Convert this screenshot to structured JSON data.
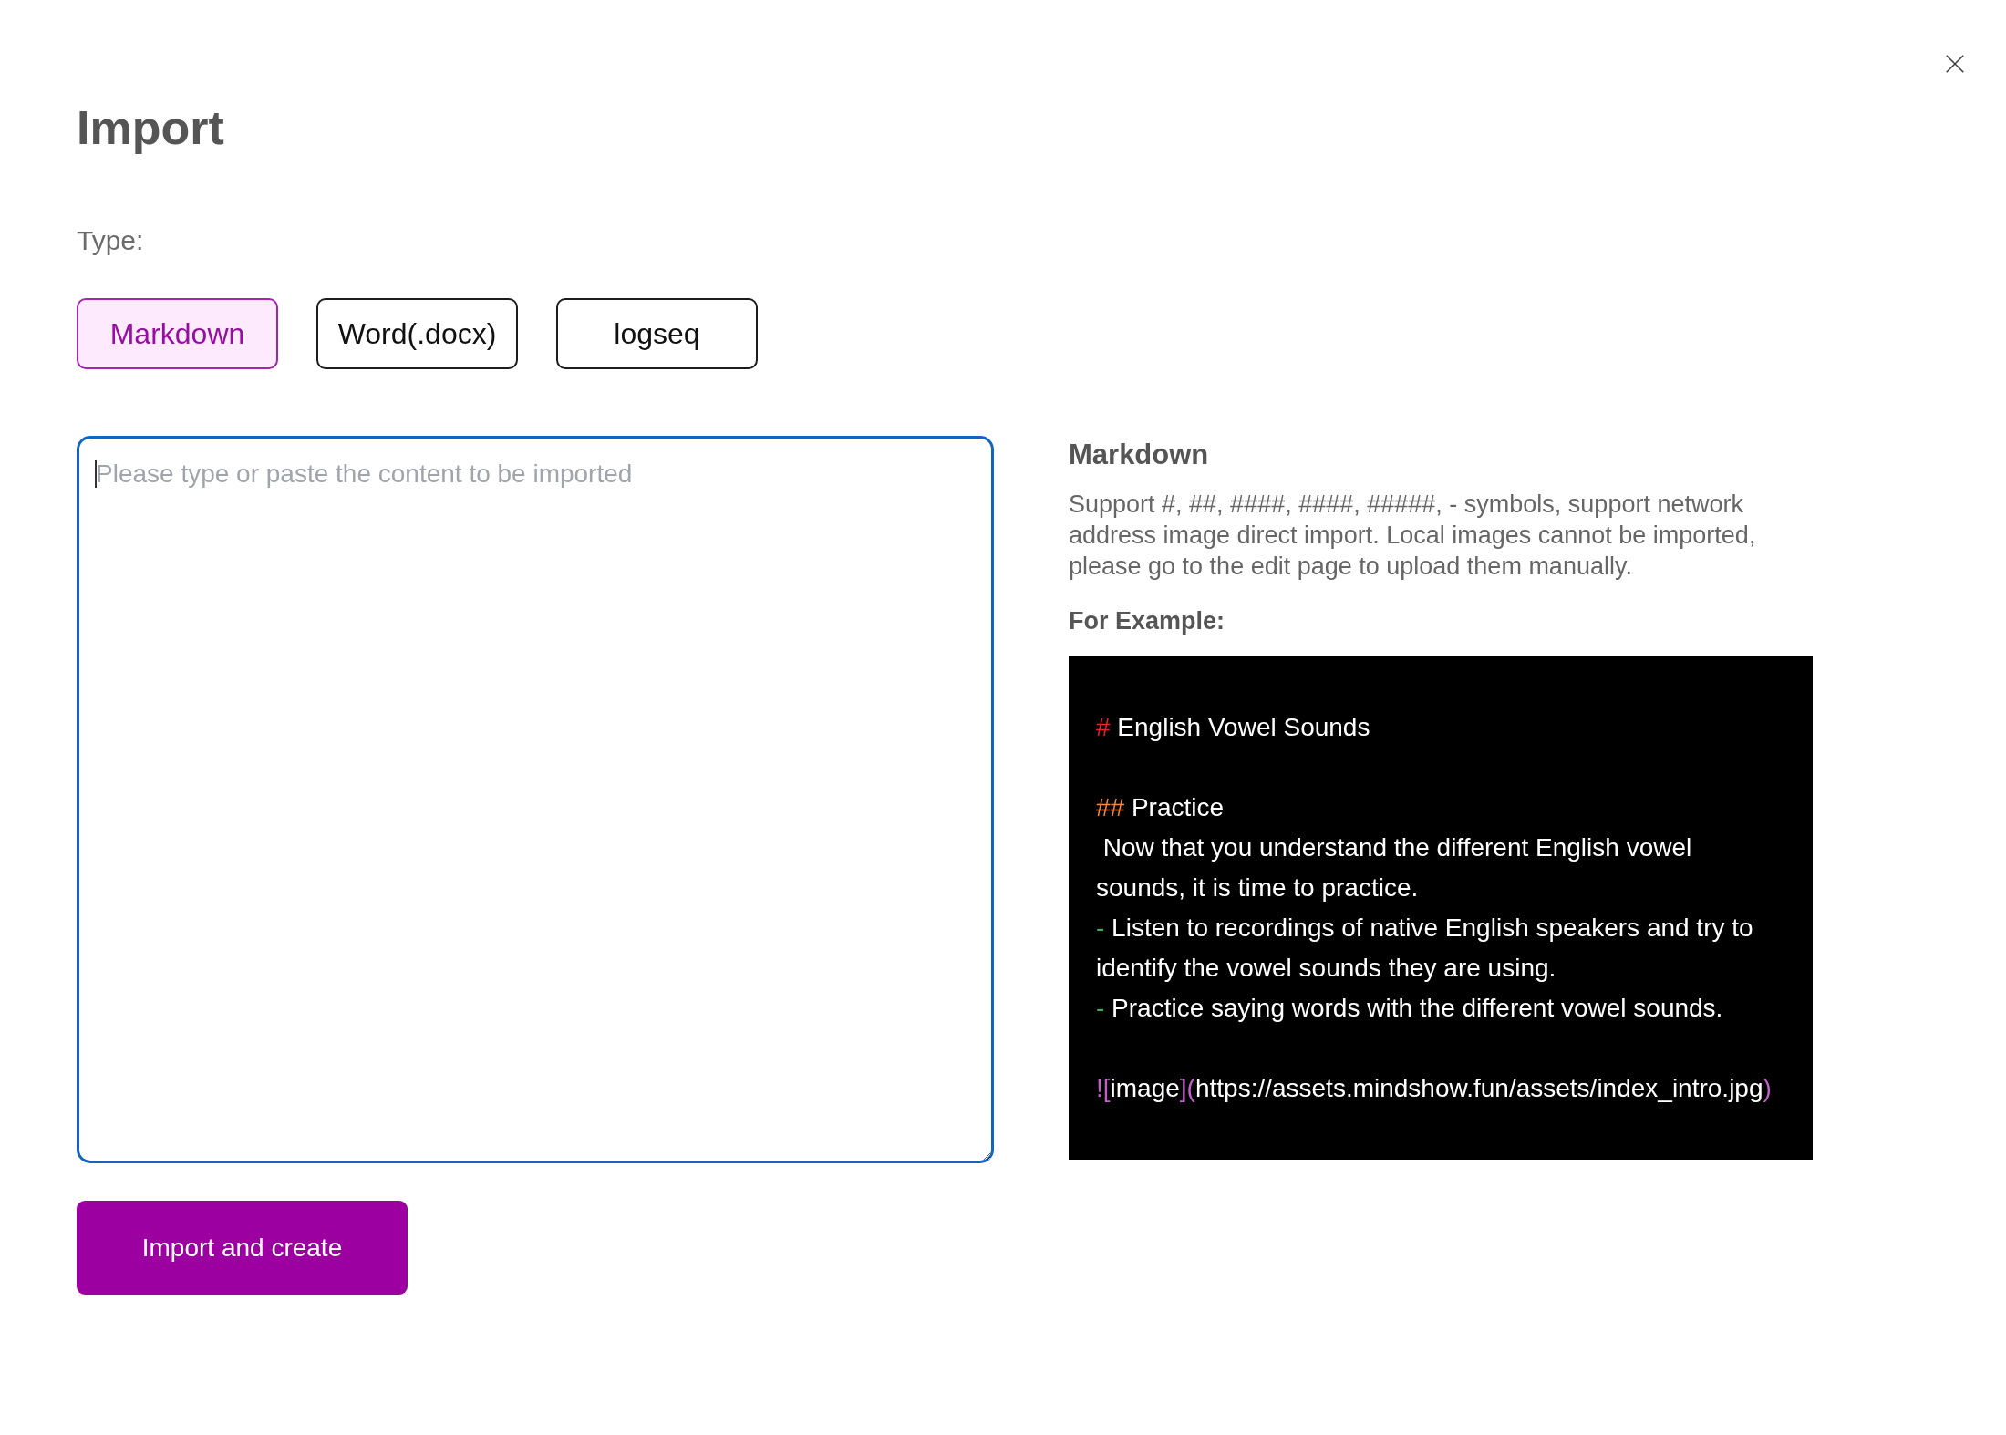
{
  "dialog": {
    "title": "Import"
  },
  "type_label": "Type:",
  "types": [
    {
      "label": "Markdown",
      "selected": true
    },
    {
      "label": "Word(.docx)",
      "selected": false
    },
    {
      "label": "logseq",
      "selected": false
    }
  ],
  "content_input": {
    "placeholder": "Please type or paste the content to be imported",
    "focused": true
  },
  "submit_button": "Import and create",
  "help": {
    "title": "Markdown",
    "description": "Support #, ##, ####, ####, #####, - symbols, support network address image direct import. Local images cannot be imported, please go to the edit page to upload them manually.",
    "example_label": "For Example:",
    "example": {
      "blocks": [
        {
          "lines": [
            {
              "segments": [
                {
                  "text": "#",
                  "kind": "syntax",
                  "color": "#e8262a"
                },
                {
                  "text": " English Vowel Sounds",
                  "kind": "text"
                }
              ]
            }
          ]
        },
        {
          "lines": [
            {
              "segments": [
                {
                  "text": "##",
                  "kind": "syntax",
                  "color": "#f0883e"
                },
                {
                  "text": " Practice",
                  "kind": "text"
                }
              ]
            },
            {
              "segments": [
                {
                  "text": " Now that you understand the different English vowel sounds, it is time to practice.",
                  "kind": "text"
                }
              ]
            },
            {
              "segments": [
                {
                  "text": "-",
                  "kind": "syntax",
                  "color": "#4aa84a"
                },
                {
                  "text": " Listen to recordings of native English speakers and try to identify the vowel sounds they are using.",
                  "kind": "text"
                }
              ]
            },
            {
              "segments": [
                {
                  "text": "-",
                  "kind": "syntax",
                  "color": "#4aa84a"
                },
                {
                  "text": " Practice saying words with the different vowel sounds.",
                  "kind": "text"
                }
              ]
            }
          ]
        },
        {
          "lines": [
            {
              "segments": [
                {
                  "text": "![",
                  "kind": "syntax",
                  "color": "#c060c8"
                },
                {
                  "text": "image",
                  "kind": "text"
                },
                {
                  "text": "](",
                  "kind": "syntax",
                  "color": "#c060c8"
                },
                {
                  "text": "https://assets.mindshow.fun/assets/index_intro.jpg",
                  "kind": "text"
                },
                {
                  "text": ")",
                  "kind": "syntax",
                  "color": "#c060c8"
                }
              ]
            }
          ]
        }
      ]
    }
  }
}
